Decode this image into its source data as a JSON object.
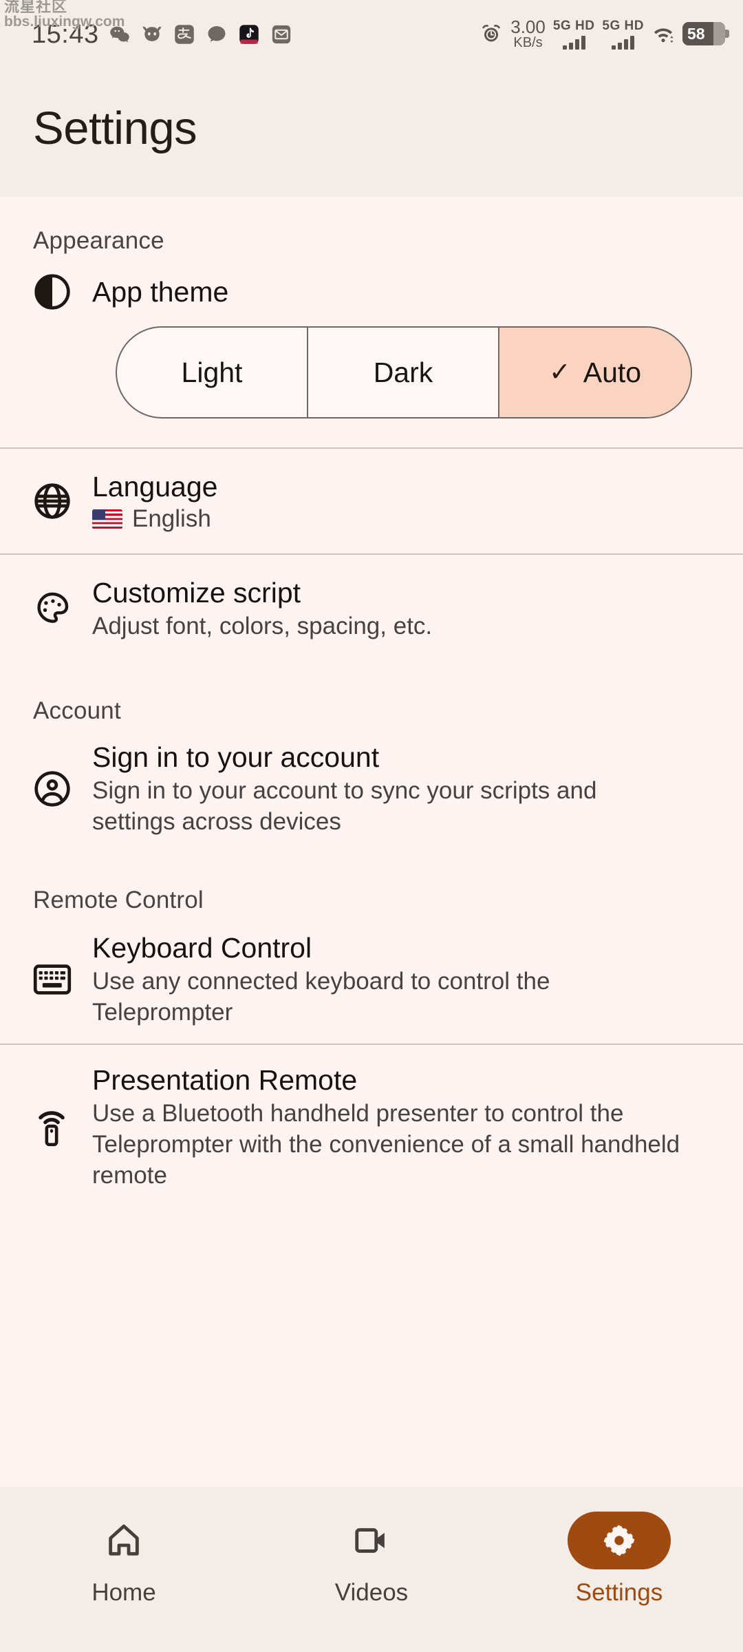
{
  "watermark": {
    "line1": "流星社区",
    "line2": "bbs.liuxingw.com"
  },
  "statusbar": {
    "time": "15:43",
    "app_icons": [
      "wechat-icon",
      "bull-mask-icon",
      "alipay-icon",
      "chat-bubble-icon",
      "tiktok-icon",
      "mail-icon"
    ],
    "alarm_icon": "alarm-clock-icon",
    "netspeed_value": "3.00",
    "netspeed_unit": "KB/s",
    "sim1_label": "5G HD",
    "sim2_label": "5G HD",
    "wifi_icon": "wifi-icon",
    "battery_percent": "58"
  },
  "header": {
    "title": "Settings"
  },
  "sections": [
    {
      "label": "Appearance",
      "rows": [
        {
          "name": "app-theme",
          "icon": "contrast-half-circle-icon",
          "title": "App theme",
          "options": [
            {
              "label": "Light",
              "selected": false
            },
            {
              "label": "Dark",
              "selected": false
            },
            {
              "label": "Auto",
              "selected": true
            }
          ]
        },
        {
          "name": "language",
          "icon": "globe-icon",
          "title": "Language",
          "flag": "us-flag-icon",
          "subtitle": "English"
        },
        {
          "name": "customize-script",
          "icon": "palette-icon",
          "title": "Customize script",
          "subtitle": "Adjust font, colors, spacing, etc."
        }
      ]
    },
    {
      "label": "Account",
      "rows": [
        {
          "name": "sign-in",
          "icon": "account-circle-icon",
          "title": "Sign in to your account",
          "subtitle": "Sign in to your account to sync your scripts and settings across devices"
        }
      ]
    },
    {
      "label": "Remote Control",
      "rows": [
        {
          "name": "keyboard-control",
          "icon": "keyboard-icon",
          "title": "Keyboard Control",
          "subtitle": "Use any connected keyboard to control the Teleprompter"
        },
        {
          "name": "presentation-remote",
          "icon": "remote-signal-icon",
          "title": "Presentation Remote",
          "subtitle": "Use a Bluetooth handheld presenter to control the Teleprompter with the convenience of a small handheld remote"
        }
      ]
    }
  ],
  "bottomnav": {
    "items": [
      {
        "label": "Home",
        "icon": "home-icon",
        "active": false
      },
      {
        "label": "Videos",
        "icon": "video-camera-icon",
        "active": false
      },
      {
        "label": "Settings",
        "icon": "gear-icon",
        "active": true
      }
    ]
  },
  "colors": {
    "header_bg": "#F4EDE7",
    "content_bg": "#FDF4F2",
    "accent_brown": "#9E4A10",
    "selected_segment": "#FBD4C1",
    "divider": "#cdc5c0",
    "text_primary": "#171210",
    "text_secondary": "#474140"
  }
}
